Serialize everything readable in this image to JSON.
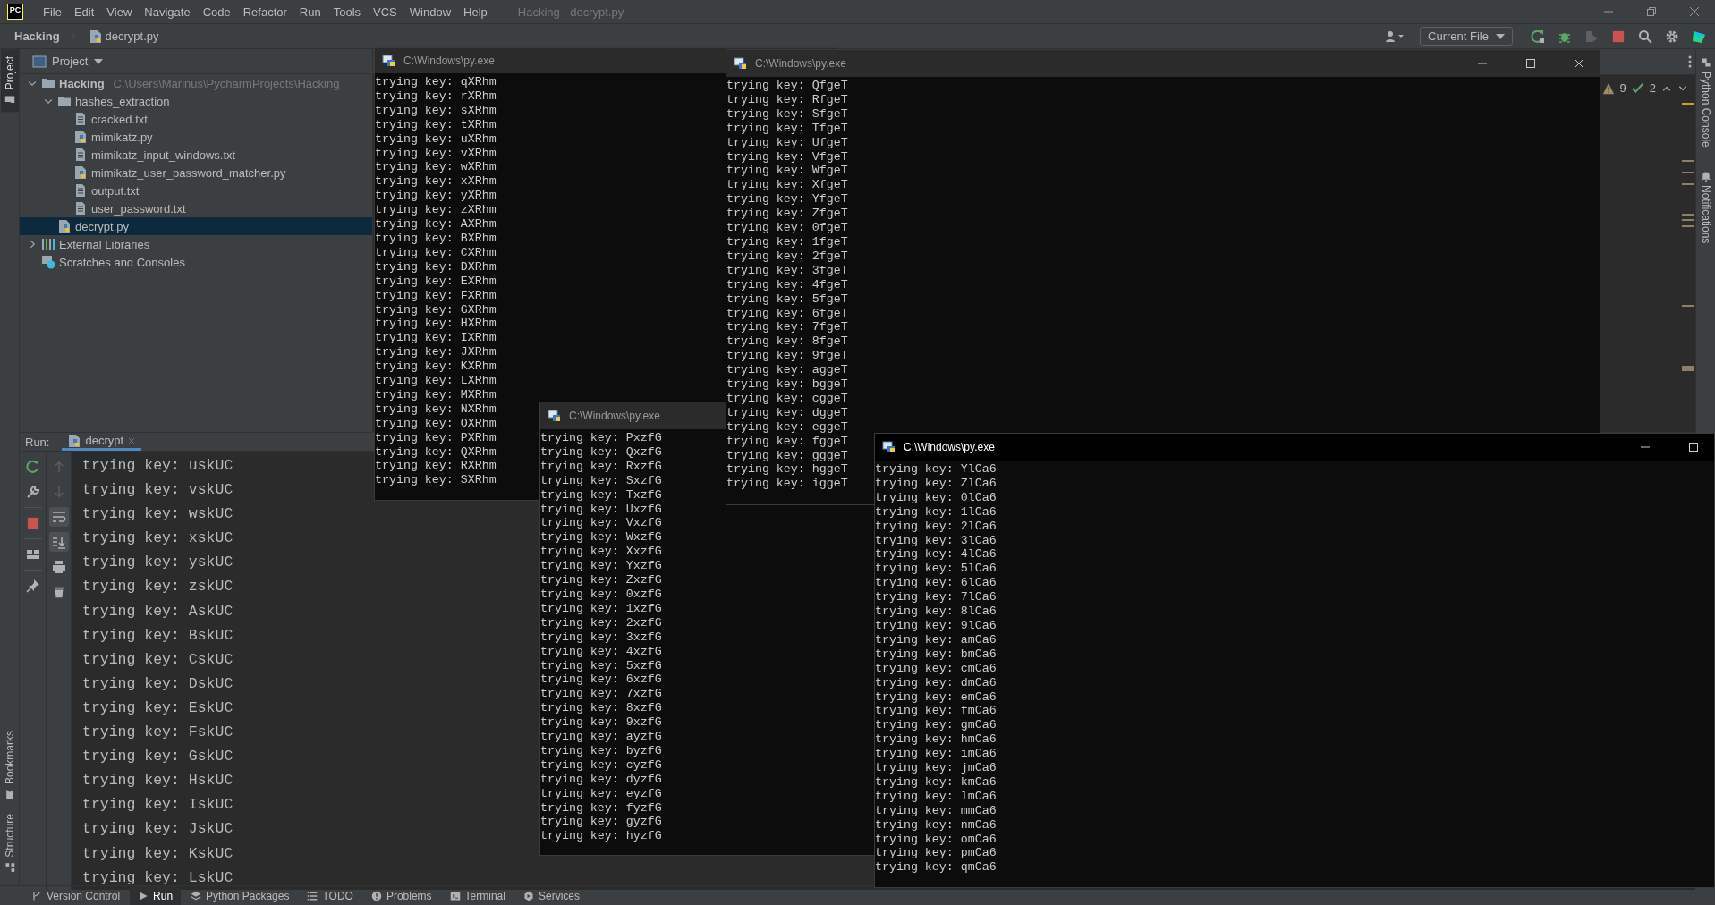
{
  "menu_bar": {
    "logo": "PC",
    "items": [
      "File",
      "Edit",
      "View",
      "Navigate",
      "Code",
      "Refactor",
      "Run",
      "Tools",
      "VCS",
      "Window",
      "Help"
    ],
    "title": "Hacking - decrypt.py"
  },
  "navigation_bar": {
    "breadcrumbs": [
      "Hacking",
      "decrypt.py"
    ],
    "run_configuration": "Current File"
  },
  "left_stripe": {
    "top": [
      {
        "label": "Project",
        "selected": true
      }
    ],
    "bottom": [
      {
        "label": "Bookmarks",
        "selected": false
      },
      {
        "label": "Structure",
        "selected": false
      }
    ]
  },
  "project_panel": {
    "title": "Project",
    "tree": [
      {
        "label": "Hacking",
        "path": "C:\\Users\\Marinus\\PycharmProjects\\Hacking",
        "kind": "folder",
        "expanded": true,
        "selected": false,
        "children": [
          {
            "label": "hashes_extraction",
            "kind": "folder",
            "expanded": true,
            "selected": false,
            "children": [
              {
                "label": "cracked.txt",
                "kind": "text",
                "selected": false
              },
              {
                "label": "mimikatz.py",
                "kind": "python",
                "selected": false
              },
              {
                "label": "mimikatz_input_windows.txt",
                "kind": "text",
                "selected": false
              },
              {
                "label": "mimikatz_user_password_matcher.py",
                "kind": "python",
                "selected": false
              },
              {
                "label": "output.txt",
                "kind": "text",
                "selected": false
              },
              {
                "label": "user_password.txt",
                "kind": "text",
                "selected": false
              }
            ]
          },
          {
            "label": "decrypt.py",
            "kind": "python",
            "selected": true
          }
        ]
      },
      {
        "label": "External Libraries",
        "kind": "libraries",
        "expanded": false,
        "selected": false
      },
      {
        "label": "Scratches and Consoles",
        "kind": "scratches",
        "selected": false
      }
    ]
  },
  "editor": {
    "warnings": "9",
    "weak_warnings": "2"
  },
  "right_stripe": [
    {
      "label": "Python Console"
    },
    {
      "label": "Notifications"
    }
  ],
  "run_panel": {
    "label": "Run:",
    "tab": "decrypt",
    "soft_wrap": true,
    "scroll_to_end": true,
    "lines": [
      "trying key: uskUC",
      "trying key: vskUC",
      "trying key: wskUC",
      "trying key: xskUC",
      "trying key: yskUC",
      "trying key: zskUC",
      "trying key: AskUC",
      "trying key: BskUC",
      "trying key: CskUC",
      "trying key: DskUC",
      "trying key: EskUC",
      "trying key: FskUC",
      "trying key: GskUC",
      "trying key: HskUC",
      "trying key: IskUC",
      "trying key: JskUC",
      "trying key: KskUC",
      "trying key: LskUC"
    ]
  },
  "tool_window_bar": [
    {
      "label": "Version Control",
      "selected": false
    },
    {
      "label": "Run",
      "selected": true
    },
    {
      "label": "Python Packages",
      "selected": false
    },
    {
      "label": "TODO",
      "selected": false
    },
    {
      "label": "Problems",
      "selected": false
    },
    {
      "label": "Terminal",
      "selected": false
    },
    {
      "label": "Services",
      "selected": false
    }
  ],
  "console_windows": [
    {
      "title": "C:\\Windows\\py.exe",
      "active": false,
      "lines": [
        "trying key: qXRhm",
        "trying key: rXRhm",
        "trying key: sXRhm",
        "trying key: tXRhm",
        "trying key: uXRhm",
        "trying key: vXRhm",
        "trying key: wXRhm",
        "trying key: xXRhm",
        "trying key: yXRhm",
        "trying key: zXRhm",
        "trying key: AXRhm",
        "trying key: BXRhm",
        "trying key: CXRhm",
        "trying key: DXRhm",
        "trying key: EXRhm",
        "trying key: FXRhm",
        "trying key: GXRhm",
        "trying key: HXRhm",
        "trying key: IXRhm",
        "trying key: JXRhm",
        "trying key: KXRhm",
        "trying key: LXRhm",
        "trying key: MXRhm",
        "trying key: NXRhm",
        "trying key: OXRhm",
        "trying key: PXRhm",
        "trying key: QXRhm",
        "trying key: RXRhm",
        "trying key: SXRhm"
      ]
    },
    {
      "title": "C:\\Windows\\py.exe",
      "active": false,
      "lines": [
        "trying key: PxzfG",
        "trying key: QxzfG",
        "trying key: RxzfG",
        "trying key: SxzfG",
        "trying key: TxzfG",
        "trying key: UxzfG",
        "trying key: VxzfG",
        "trying key: WxzfG",
        "trying key: XxzfG",
        "trying key: YxzfG",
        "trying key: ZxzfG",
        "trying key: 0xzfG",
        "trying key: 1xzfG",
        "trying key: 2xzfG",
        "trying key: 3xzfG",
        "trying key: 4xzfG",
        "trying key: 5xzfG",
        "trying key: 6xzfG",
        "trying key: 7xzfG",
        "trying key: 8xzfG",
        "trying key: 9xzfG",
        "trying key: ayzfG",
        "trying key: byzfG",
        "trying key: cyzfG",
        "trying key: dyzfG",
        "trying key: eyzfG",
        "trying key: fyzfG",
        "trying key: gyzfG",
        "trying key: hyzfG"
      ]
    },
    {
      "title": "C:\\Windows\\py.exe",
      "active": false,
      "controls": [
        {
          "kind": "minimize"
        },
        {
          "kind": "maximize"
        },
        {
          "kind": "close"
        }
      ],
      "lines": [
        "trying key: QfgeT",
        "trying key: RfgeT",
        "trying key: SfgeT",
        "trying key: TfgeT",
        "trying key: UfgeT",
        "trying key: VfgeT",
        "trying key: WfgeT",
        "trying key: XfgeT",
        "trying key: YfgeT",
        "trying key: ZfgeT",
        "trying key: 0fgeT",
        "trying key: 1fgeT",
        "trying key: 2fgeT",
        "trying key: 3fgeT",
        "trying key: 4fgeT",
        "trying key: 5fgeT",
        "trying key: 6fgeT",
        "trying key: 7fgeT",
        "trying key: 8fgeT",
        "trying key: 9fgeT",
        "trying key: aggeT",
        "trying key: bggeT",
        "trying key: cggeT",
        "trying key: dggeT",
        "trying key: eggeT",
        "trying key: fggeT",
        "trying key: gggeT",
        "trying key: hggeT",
        "trying key: iggeT"
      ]
    },
    {
      "title": "C:\\Windows\\py.exe",
      "active": true,
      "controls": [
        {
          "kind": "minimize"
        },
        {
          "kind": "maximize"
        }
      ],
      "lines": [
        "trying key: YlCa6",
        "trying key: ZlCa6",
        "trying key: 0lCa6",
        "trying key: 1lCa6",
        "trying key: 2lCa6",
        "trying key: 3lCa6",
        "trying key: 4lCa6",
        "trying key: 5lCa6",
        "trying key: 6lCa6",
        "trying key: 7lCa6",
        "trying key: 8lCa6",
        "trying key: 9lCa6",
        "trying key: amCa6",
        "trying key: bmCa6",
        "trying key: cmCa6",
        "trying key: dmCa6",
        "trying key: emCa6",
        "trying key: fmCa6",
        "trying key: gmCa6",
        "trying key: hmCa6",
        "trying key: imCa6",
        "trying key: jmCa6",
        "trying key: kmCa6",
        "trying key: lmCa6",
        "trying key: mmCa6",
        "trying key: nmCa6",
        "trying key: omCa6",
        "trying key: pmCa6",
        "trying key: qmCa6"
      ]
    }
  ]
}
